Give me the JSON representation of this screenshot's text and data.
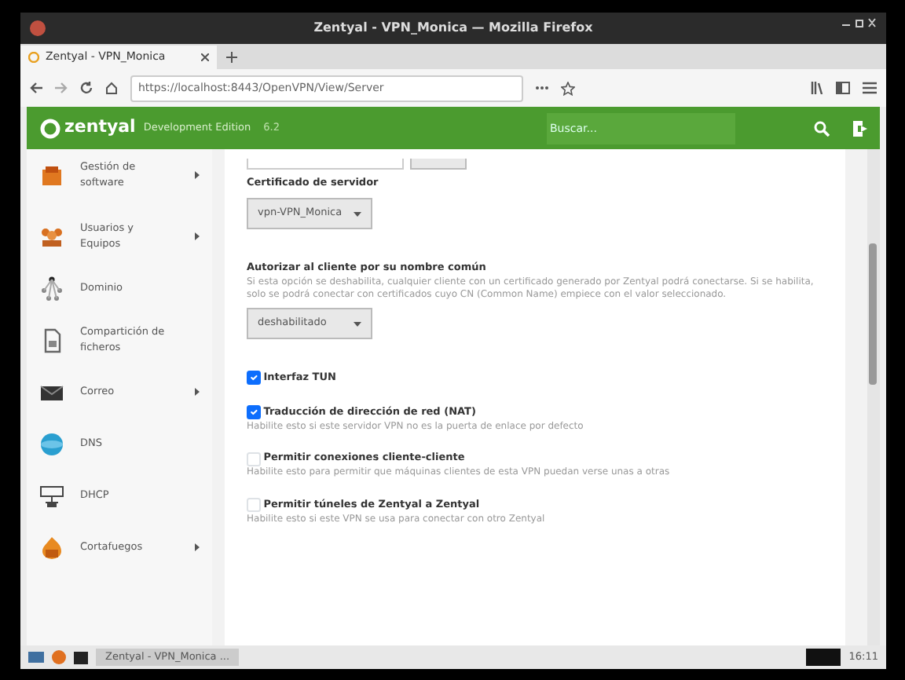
{
  "window": {
    "title": "Zentyal - VPN_Monica — Mozilla Firefox"
  },
  "tabs": [
    {
      "label": "Zentyal - VPN_Monica",
      "selected": true
    }
  ],
  "address_bar": {
    "url": "https://localhost:8443/OpenVPN/View/Server"
  },
  "header": {
    "brand": "zentyal",
    "edition": "Development Edition",
    "version": "6.2",
    "search": {
      "placeholder": "Buscar..."
    }
  },
  "sidebar": {
    "items": [
      {
        "label": "Gestión de software",
        "kind": "package",
        "expandable": true
      },
      {
        "label": "Usuarios y Equipos",
        "kind": "users",
        "expandable": true
      },
      {
        "label": "Dominio",
        "kind": "domain",
        "expandable": false
      },
      {
        "label": "Compartición de ficheros",
        "kind": "file",
        "expandable": false
      },
      {
        "label": "Correo",
        "kind": "mail",
        "expandable": true
      },
      {
        "label": "DNS",
        "kind": "dns",
        "expandable": false
      },
      {
        "label": "DHCP",
        "kind": "dhcp",
        "expandable": false
      },
      {
        "label": "Cortafuegos",
        "kind": "firewall",
        "expandable": true
      }
    ]
  },
  "form": [
    {
      "kind": "select",
      "label": "Certificado de servidor",
      "value": "vpn-VPN_Monica"
    },
    {
      "kind": "select",
      "label": "Autorizar al cliente por su nombre común",
      "help": "Si esta opción se deshabilita, cualquier cliente con un certificado generado por Zentyal podrá conectarse. Si se habilita, solo se podrá conectar con certificados cuyo CN (Common Name) empiece con el valor seleccionado.",
      "value": "deshabilitado"
    },
    {
      "kind": "checkbox",
      "label": "Interfaz TUN",
      "checked": true
    },
    {
      "kind": "checkbox",
      "label": "Traducción de dirección de red (NAT)",
      "help": "Habilite esto si este servidor VPN no es la puerta de enlace por defecto",
      "checked": true
    },
    {
      "kind": "checkbox",
      "label": "Permitir conexiones cliente-cliente",
      "help": "Habilite esto para permitir que máquinas clientes de esta VPN puedan verse unas a otras",
      "checked": false
    },
    {
      "kind": "checkbox",
      "label": "Permitir túneles de Zentyal a Zentyal",
      "help": "Habilite esto si este VPN se usa para conectar con otro Zentyal",
      "checked": false
    }
  ],
  "taskbar": {
    "task": "Zentyal - VPN_Monica ...",
    "clock": "16:11"
  }
}
